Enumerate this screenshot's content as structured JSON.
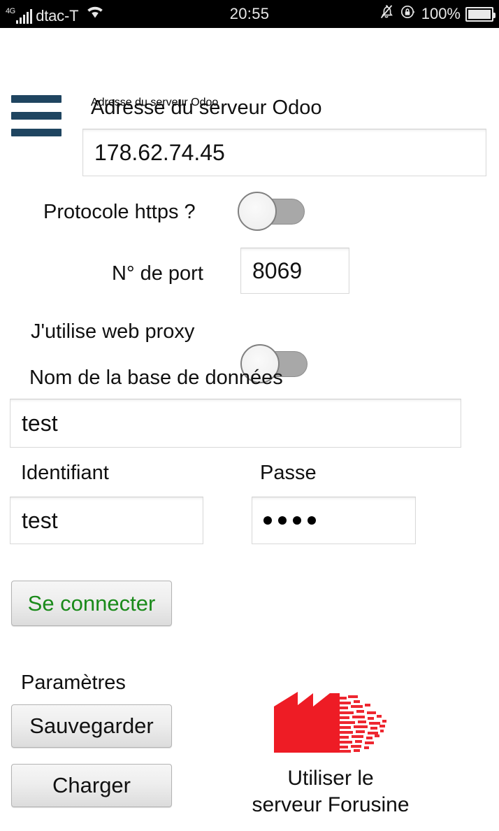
{
  "status_bar": {
    "network_type": "4G",
    "carrier": "dtac-T",
    "wifi_icon": "wifi-icon",
    "time": "20:55",
    "mute_icon": "bell-mute-icon",
    "rotation_lock_icon": "rotation-lock-icon",
    "battery_percent": "100%",
    "battery_icon": "battery-full-icon"
  },
  "menu": {
    "icon": "hamburger-menu-icon",
    "color": "#1f4560"
  },
  "form": {
    "server_address": {
      "label": "Adresse du serveur Odoo",
      "value": "178.62.74.45",
      "placeholder": "Adresse du serveur Odoo"
    },
    "https": {
      "label": "Protocole https ?",
      "state": "off"
    },
    "port": {
      "label": "N° de port",
      "value": "8069",
      "placeholder": "8069"
    },
    "proxy": {
      "label": "J'utilise web proxy",
      "state": "off"
    },
    "database": {
      "label": "Nom de la base de données",
      "value": "test",
      "placeholder": "Nom de la base de données"
    },
    "login": {
      "label": "Identifiant",
      "value": "test",
      "placeholder": "Identifiant"
    },
    "password": {
      "label": "Passe",
      "value": "••••",
      "mask_count": 4,
      "placeholder": "Passe"
    }
  },
  "connect_button": {
    "label": "Se connecter",
    "text_color": "#1a8a1a"
  },
  "settings": {
    "title": "Paramètres",
    "save_label": "Sauvegarder",
    "load_label": "Charger"
  },
  "forusine": {
    "logo_icon": "forusine-factory-logo",
    "logo_color": "#ee1c25",
    "caption_line1": "Utiliser le",
    "caption_line2": "serveur Forusine"
  }
}
